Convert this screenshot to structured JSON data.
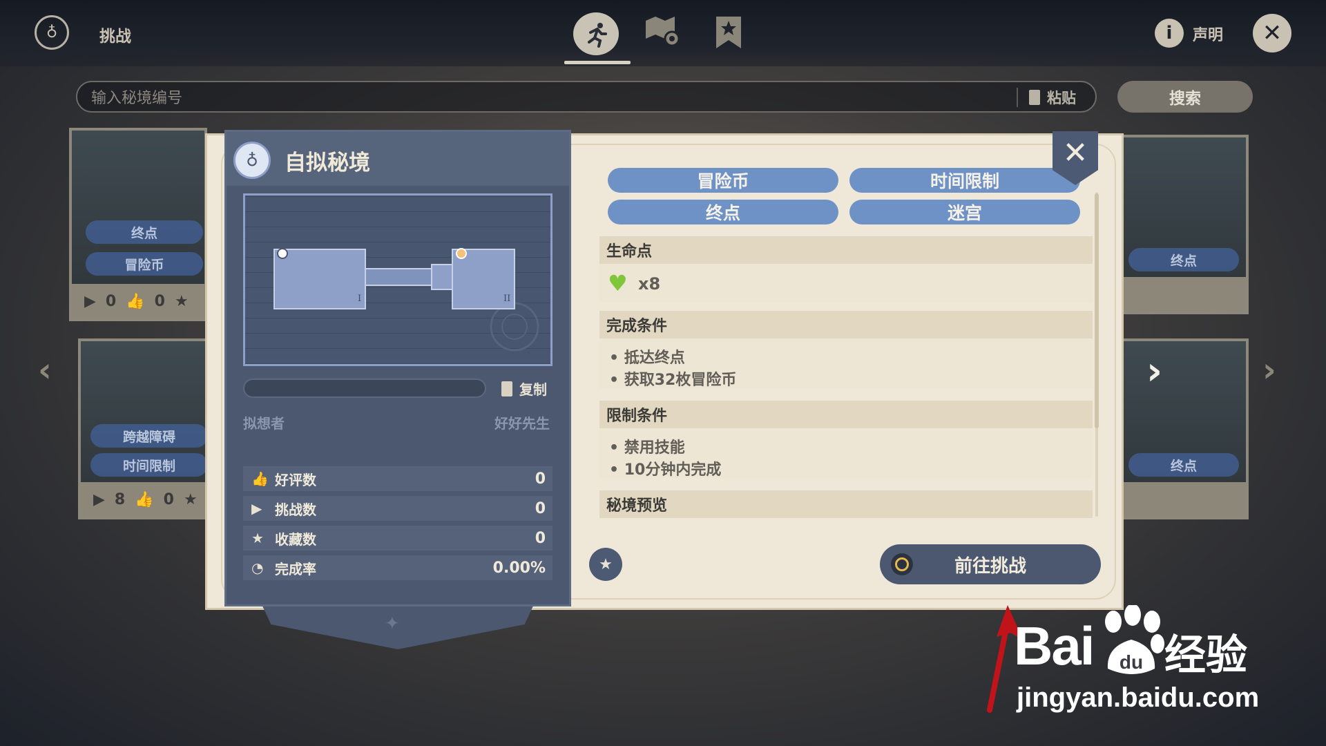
{
  "header": {
    "title": "挑战",
    "disclaimer_label": "声明"
  },
  "search": {
    "placeholder": "输入秘境编号",
    "paste_label": "粘贴",
    "button_label": "搜索"
  },
  "background_cards": [
    {
      "tags": [
        "终点",
        "冒险币"
      ],
      "plays": "0",
      "likes": "0"
    },
    {
      "tags": [
        "跨越障碍",
        "时间限制"
      ],
      "plays": "8",
      "likes": "0"
    },
    {
      "tags": [
        "终点"
      ]
    },
    {
      "tags": [
        "终点"
      ]
    }
  ],
  "detail": {
    "title": "自拟秘境",
    "map_labels": [
      "I",
      "II"
    ],
    "copy_label": "复制",
    "creator_label": "拟想者",
    "creator_name": "好好先生",
    "stats": [
      {
        "label": "好评数",
        "value": "0",
        "icon": "thumbs-up-icon"
      },
      {
        "label": "挑战数",
        "value": "0",
        "icon": "play-icon"
      },
      {
        "label": "收藏数",
        "value": "0",
        "icon": "star-icon"
      },
      {
        "label": "完成率",
        "value": "0.00%",
        "icon": "pie-icon"
      }
    ],
    "tags": [
      "冒险币",
      "时间限制",
      "终点",
      "迷宫"
    ],
    "sections": {
      "life": {
        "title": "生命点",
        "count": "x8"
      },
      "completion": {
        "title": "完成条件",
        "items": [
          "抵达终点",
          "获取32枚冒险币"
        ]
      },
      "restriction": {
        "title": "限制条件",
        "items": [
          "禁用技能",
          "10分钟内完成"
        ]
      },
      "preview": {
        "title": "秘境预览"
      }
    },
    "go_button": "前往挑战",
    "colors": {
      "pill": "#6e91c6",
      "panel": "#4b5870",
      "heart": "#7fc63a",
      "arrow": "#c0141a"
    }
  },
  "watermark": {
    "brand": "Bai",
    "brand_suffix": "经验",
    "url": "jingyan.baidu.com"
  }
}
